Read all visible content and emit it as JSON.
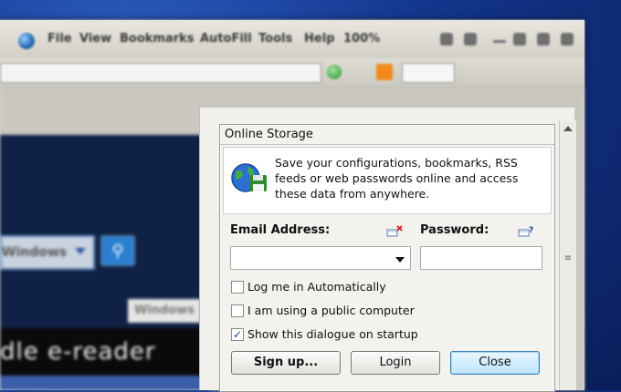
{
  "browser": {
    "menu": [
      "File",
      "View",
      "Bookmarks",
      "AutoFill",
      "Tools",
      "Help"
    ],
    "zoom": "100%"
  },
  "website": {
    "dropdown_value": "Windows",
    "tab_label": "Windows",
    "banner_text": "dle e-reader"
  },
  "dialog": {
    "title": "Online Storage",
    "info_text": "Save your configurations, bookmarks, RSS feeds or web passwords online and access these data from anywhere.",
    "email_label": "Email Address:",
    "email_value": "",
    "password_label": "Password:",
    "password_value": "",
    "checkboxes": [
      {
        "label": "Log me in Automatically",
        "checked": false
      },
      {
        "label": "I am using a public computer",
        "checked": false
      },
      {
        "label": "Show this dialogue on startup",
        "checked": true
      }
    ],
    "buttons": {
      "signup": "Sign up...",
      "login": "Login",
      "close": "Close"
    }
  },
  "colors": {
    "desktop": "#13358c",
    "close_button_bg": "#bee6fd",
    "email_icon_mark": "#d01010"
  }
}
